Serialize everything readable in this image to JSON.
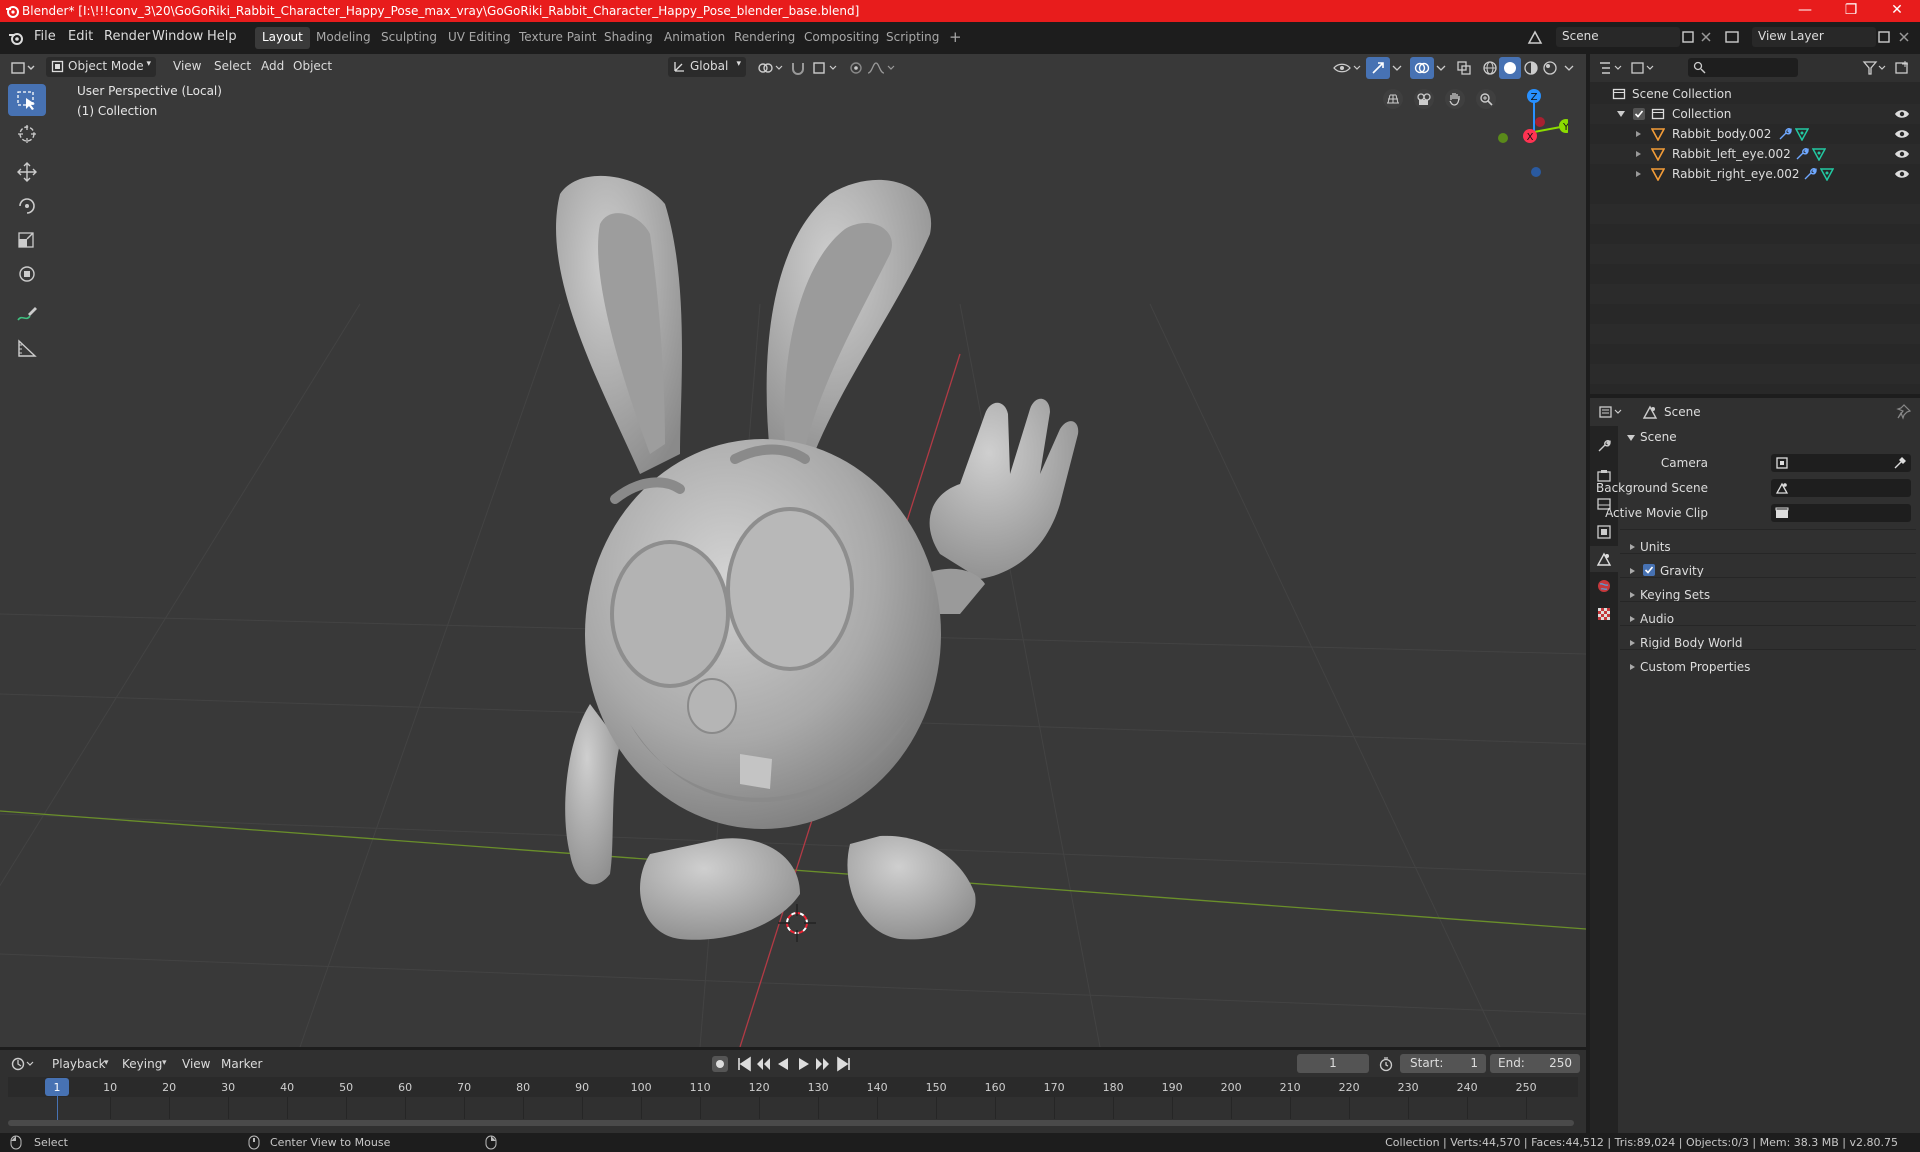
{
  "window": {
    "title": "Blender* [I:\\!!!conv_3\\20\\GoGoRiki_Rabbit_Character_Happy_Pose_max_vray\\GoGoRiki_Rabbit_Character_Happy_Pose_blender_base.blend]",
    "minimize": "—",
    "maximize": "❐",
    "close": "✕"
  },
  "menu": {
    "file": "File",
    "edit": "Edit",
    "render": "Render",
    "window": "Window",
    "help": "Help"
  },
  "workspaces": [
    "Layout",
    "Modeling",
    "Sculpting",
    "UV Editing",
    "Texture Paint",
    "Shading",
    "Animation",
    "Rendering",
    "Compositing",
    "Scripting"
  ],
  "workspace_add": "+",
  "scene_field": "Scene",
  "view_layer_field": "View Layer",
  "viewport": {
    "mode": "Object Mode",
    "menus": {
      "view": "View",
      "select": "Select",
      "add": "Add",
      "object": "Object"
    },
    "transform_orientation": "Global",
    "info_line1": "User Perspective (Local)",
    "info_line2": "(1) Collection",
    "gizmo": {
      "z": "Z",
      "y": "Y",
      "x": "X"
    }
  },
  "outliner": {
    "search_placeholder": "",
    "scene_collection": "Scene Collection",
    "collection": "Collection",
    "objects": [
      "Rabbit_body.002",
      "Rabbit_left_eye.002",
      "Rabbit_right_eye.002"
    ]
  },
  "properties": {
    "header": "Scene",
    "panel_scene": "Scene",
    "camera_label": "Camera",
    "background_scene_label": "Background Scene",
    "active_movie_clip_label": "Active Movie Clip",
    "panels": [
      "Units",
      "Gravity",
      "Keying Sets",
      "Audio",
      "Rigid Body World",
      "Custom Properties"
    ]
  },
  "timeline": {
    "playback": "Playback",
    "keying": "Keying",
    "view": "View",
    "marker": "Marker",
    "current_frame": "1",
    "start_label": "Start:",
    "start_value": "1",
    "end_label": "End:",
    "end_value": "250",
    "frame_marks": [
      "1",
      "10",
      "20",
      "30",
      "40",
      "50",
      "60",
      "70",
      "80",
      "90",
      "100",
      "110",
      "120",
      "130",
      "140",
      "150",
      "160",
      "170",
      "180",
      "190",
      "200",
      "210",
      "220",
      "230",
      "240",
      "250"
    ]
  },
  "status": {
    "select": "Select",
    "center_view": "Center View to Mouse",
    "stats": "Collection | Verts:44,570 | Faces:44,512 | Tris:89,024 | Objects:0/3 | Mem: 38.3 MB | v2.80.75"
  },
  "colors": {
    "title_bar": "#e81c1c",
    "active_tool": "#4772b3",
    "x_axis": "#ff3352",
    "y_axis": "#8bdc00",
    "z_axis": "#2890ff"
  }
}
